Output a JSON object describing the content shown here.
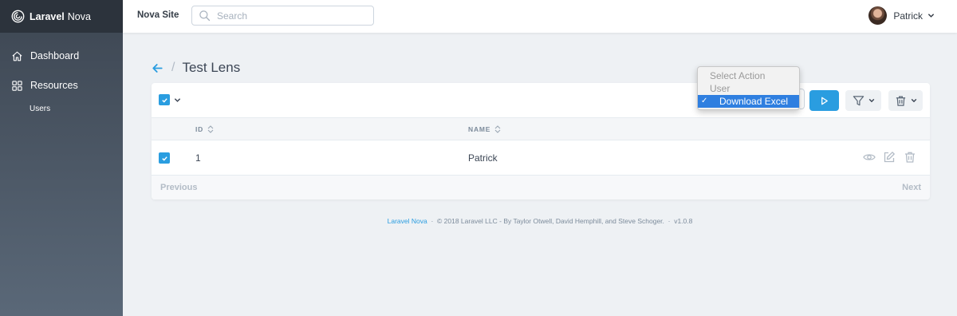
{
  "brand": {
    "bold": "Laravel",
    "light": "Nova"
  },
  "sidebar": {
    "items": [
      {
        "label": "Dashboard",
        "icon": "home-icon"
      },
      {
        "label": "Resources",
        "icon": "grid-icon"
      }
    ],
    "sub_items": [
      {
        "label": "Users"
      }
    ]
  },
  "header": {
    "site_name": "Nova Site",
    "search_placeholder": "Search",
    "user_name": "Patrick"
  },
  "page": {
    "separator": "/",
    "title": "Test Lens"
  },
  "table": {
    "columns": [
      {
        "label": "ID"
      },
      {
        "label": "NAME"
      }
    ],
    "rows": [
      {
        "id": "1",
        "name": "Patrick",
        "selected": true
      }
    ],
    "pager": {
      "previous": "Previous",
      "next": "Next"
    }
  },
  "action_select": {
    "options": [
      "Select Action",
      "User",
      "Download Excel"
    ],
    "selected": "Download Excel"
  },
  "footer": {
    "link": "Laravel Nova",
    "dot": "·",
    "copyright": "© 2018 Laravel LLC - By Taylor Otwell, David Hemphill, and Steve Schoger.",
    "version": "v1.0.8"
  },
  "colors": {
    "accent": "#2a9de0",
    "sidebar_top": "#3d4652",
    "brand_bar": "#2c333c",
    "select_highlight": "#2f7fe0"
  }
}
